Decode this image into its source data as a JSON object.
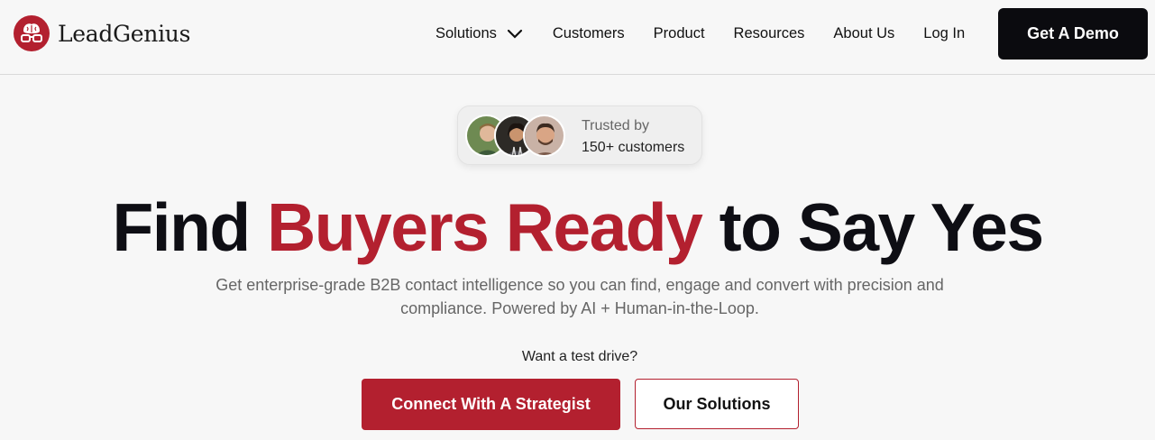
{
  "brand": {
    "name": "LeadGenius",
    "color": "#b3202f"
  },
  "nav": {
    "items": [
      {
        "label": "Solutions",
        "has_dropdown": true
      },
      {
        "label": "Customers"
      },
      {
        "label": "Product"
      },
      {
        "label": "Resources"
      },
      {
        "label": "About Us"
      },
      {
        "label": "Log In"
      }
    ],
    "cta": "Get A Demo"
  },
  "trust": {
    "line1": "Trusted by",
    "line2": "150+ customers",
    "avatars": [
      "customer-avatar-1",
      "customer-avatar-2",
      "customer-avatar-3"
    ]
  },
  "hero": {
    "headline_part1": "Find ",
    "headline_accent": "Buyers Ready",
    "headline_part2": " to Say Yes",
    "subtitle": "Get enterprise-grade B2B contact intelligence so you can find, engage and convert with precision and compliance. Powered by AI + Human-in-the-Loop.",
    "test_drive": "Want a test drive?",
    "primary_cta": "Connect With A Strategist",
    "secondary_cta": "Our Solutions"
  }
}
